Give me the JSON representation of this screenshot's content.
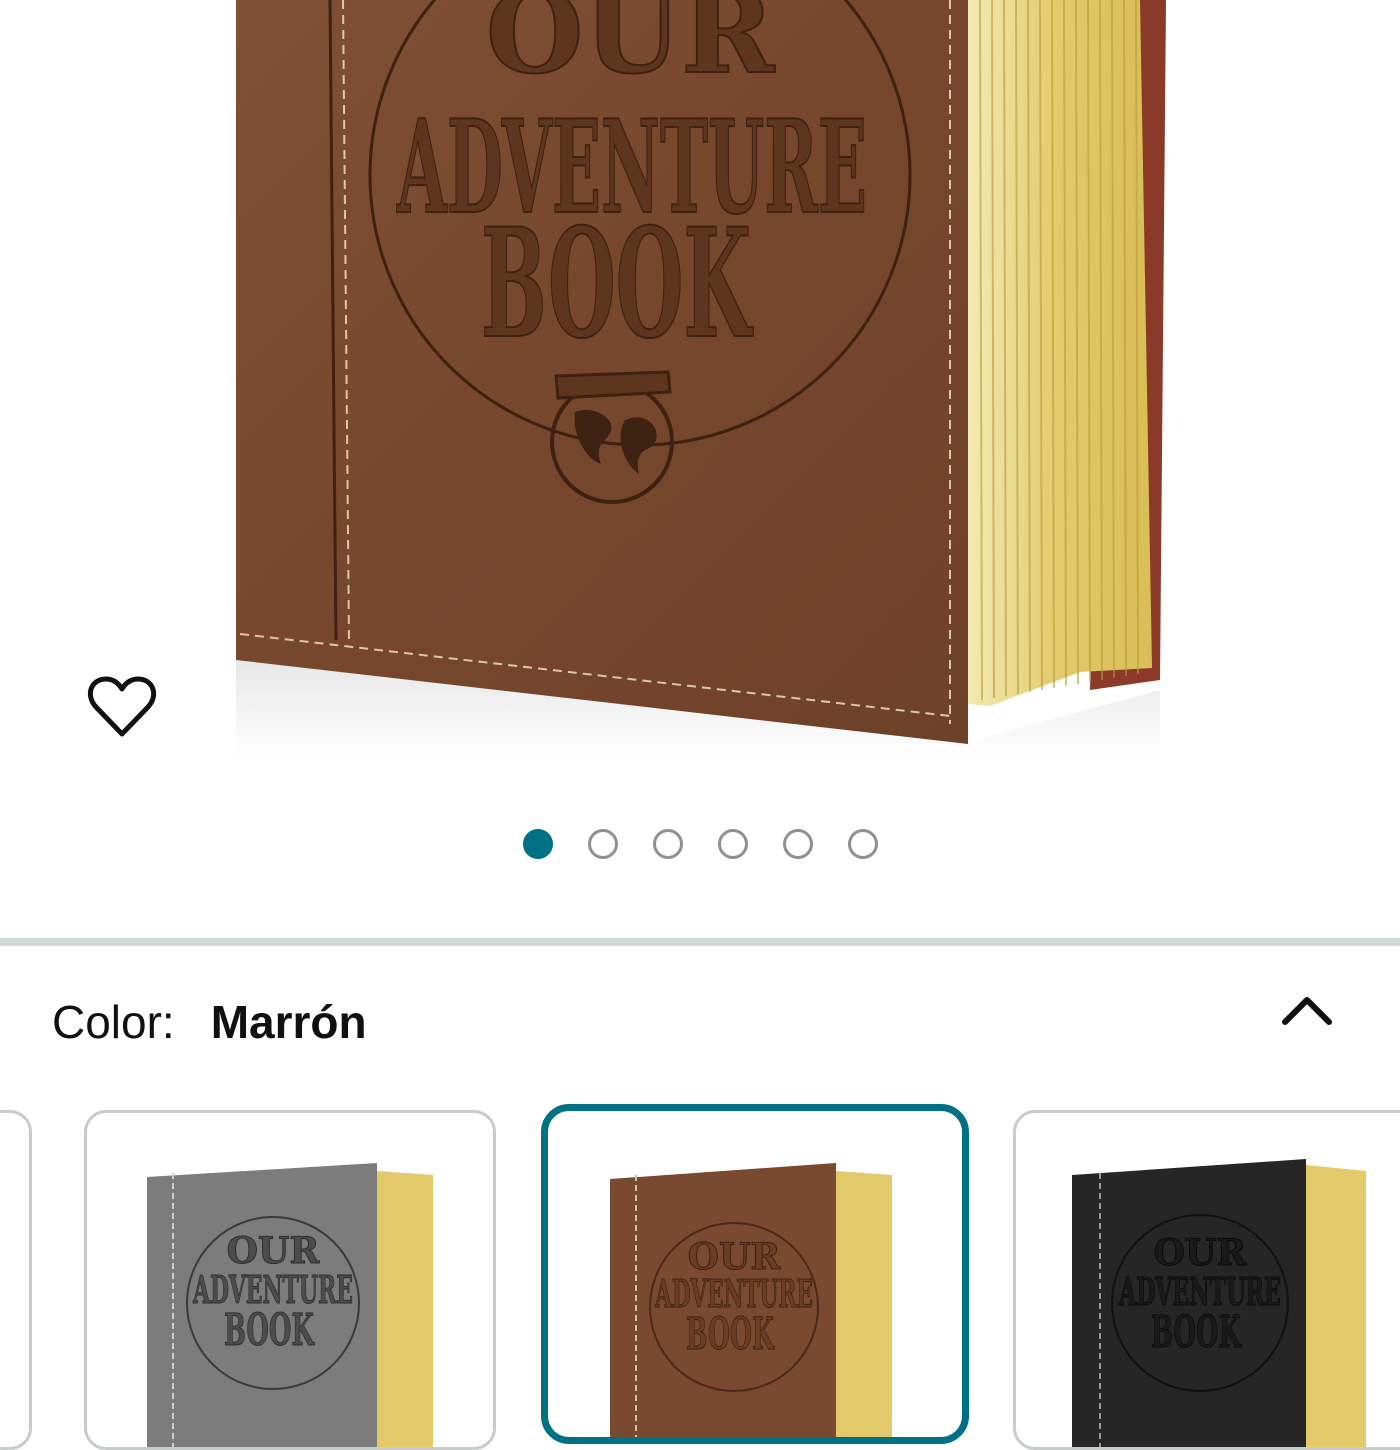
{
  "product": {
    "image_alt": "Our Adventure Book",
    "cover_text": [
      "OUR",
      "ADVENTURE",
      "BOOK"
    ]
  },
  "wishlist": {
    "icon": "heart-outline-icon"
  },
  "carousel": {
    "total": 6,
    "active": 1
  },
  "variation": {
    "label": "Color:",
    "selected_value": "Marrón",
    "toggle_icon": "chevron-up-icon"
  },
  "swatches": [
    {
      "cover_color": "#8a8a8a",
      "selected": false,
      "partial": true
    },
    {
      "cover_color": "#7c7c7c",
      "selected": false,
      "cover_text": [
        "OUR",
        "ADVENTURE",
        "BOOK"
      ]
    },
    {
      "cover_color": "#7a4a30",
      "selected": true,
      "cover_text": [
        "OUR",
        "ADVENTURE",
        "BOOK"
      ]
    },
    {
      "cover_color": "#262626",
      "selected": false,
      "cover_text": [
        "OUR",
        "ADVENTURE",
        "BOOK"
      ]
    }
  ],
  "colors": {
    "accent": "#007185",
    "leather": "#7a4a30",
    "pages": "#e3cf7a",
    "divider": "#d5d9d9"
  }
}
